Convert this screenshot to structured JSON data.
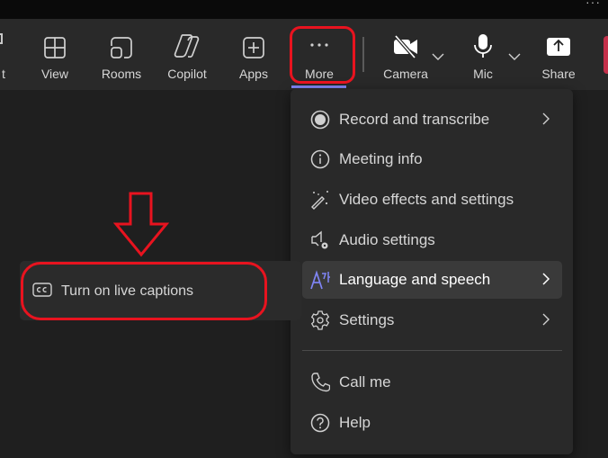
{
  "toolbar": {
    "partial_left_label": "t",
    "buttons": [
      {
        "id": "view",
        "label": "View",
        "icon": "grid-icon"
      },
      {
        "id": "rooms",
        "label": "Rooms",
        "icon": "rooms-icon"
      },
      {
        "id": "copilot",
        "label": "Copilot",
        "icon": "copilot-icon"
      },
      {
        "id": "apps",
        "label": "Apps",
        "icon": "plus-square-icon"
      },
      {
        "id": "more",
        "label": "More",
        "icon": "ellipsis-icon"
      },
      {
        "id": "camera",
        "label": "Camera",
        "icon": "camera-off-icon"
      },
      {
        "id": "mic",
        "label": "Mic",
        "icon": "microphone-icon"
      },
      {
        "id": "share",
        "label": "Share",
        "icon": "share-icon"
      }
    ],
    "window_dots": "···"
  },
  "more_menu": {
    "items": [
      {
        "label": "Record and transcribe",
        "icon": "record-icon",
        "has_submenu": true
      },
      {
        "label": "Meeting info",
        "icon": "info-icon",
        "has_submenu": false
      },
      {
        "label": "Video effects and settings",
        "icon": "magic-wand-icon",
        "has_submenu": false
      },
      {
        "label": "Audio settings",
        "icon": "speaker-settings-icon",
        "has_submenu": false
      },
      {
        "label": "Language and speech",
        "icon": "language-icon",
        "has_submenu": true,
        "highlighted": true
      },
      {
        "label": "Settings",
        "icon": "gear-icon",
        "has_submenu": true
      },
      {
        "label": "Call me",
        "icon": "phone-icon",
        "has_submenu": false
      },
      {
        "label": "Help",
        "icon": "help-icon",
        "has_submenu": false
      }
    ]
  },
  "submenu": {
    "items": [
      {
        "label": "Turn on live captions",
        "icon": "closed-captions-icon"
      }
    ]
  },
  "colors": {
    "accent": "#7f85f5",
    "annotation": "#e8131f",
    "leave_button": "#c4314b"
  }
}
